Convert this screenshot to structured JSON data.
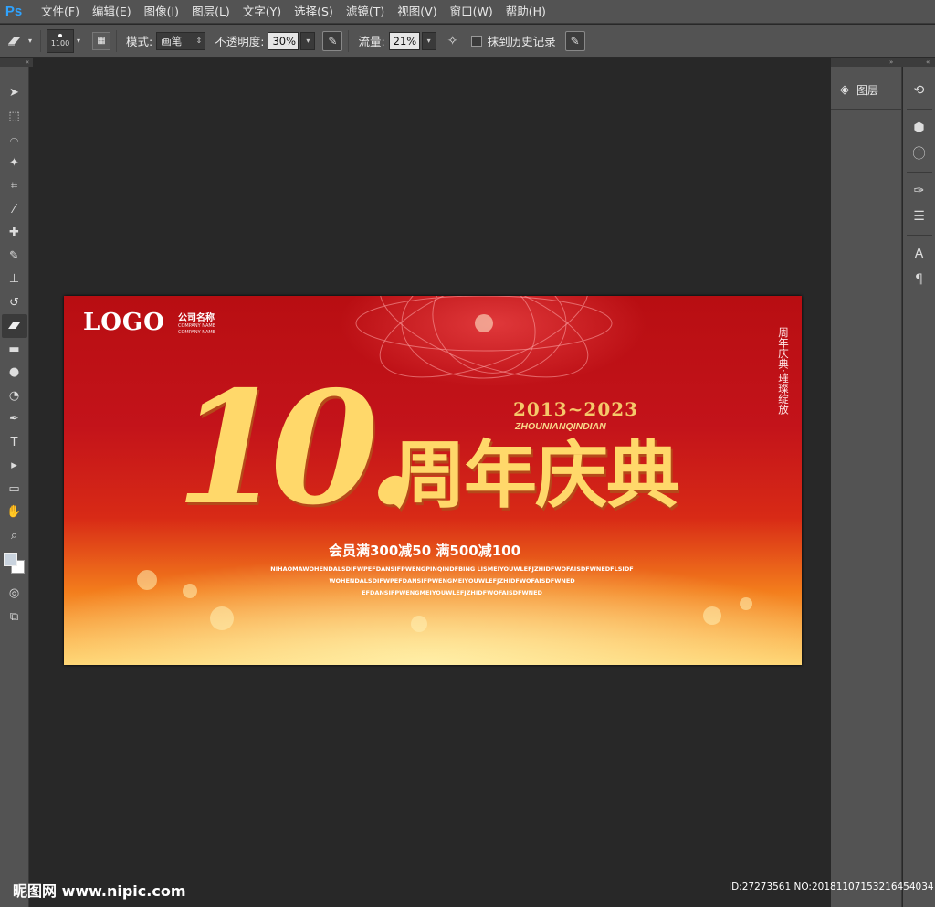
{
  "app": {
    "logo": "Ps"
  },
  "menu": [
    "文件(F)",
    "编辑(E)",
    "图像(I)",
    "图层(L)",
    "文字(Y)",
    "选择(S)",
    "滤镜(T)",
    "视图(V)",
    "窗口(W)",
    "帮助(H)"
  ],
  "options": {
    "brush_size": "1100",
    "mode_label": "模式:",
    "mode_value": "画笔",
    "opacity_label": "不透明度:",
    "opacity_value": "30%",
    "flow_label": "流量:",
    "flow_value": "21%",
    "erase_history_label": "抹到历史记录"
  },
  "panels": {
    "layers_label": "图层"
  },
  "canvas": {
    "logo": "LOGO",
    "company_cn": "公司名称",
    "company_en_1": "COMPANY NAME",
    "company_en_2": "COMPANY NAME",
    "years": "2013~2023",
    "pinyin": "ZHOUNIANQINDIAN",
    "big_number": "10.",
    "title": "周年庆典",
    "promo": "会员满300减50 满500减100",
    "small_lines": [
      "NIHAOMAWOHENDALSDIFWPEFDANSIFPWENGPINQINDFBING LISMEIYOUWLEFJZHIDFWOFAISDFWNEDFLSIDF",
      "WOHENDALSDIFWPEFDANSIFPWENGMEIYOUWLEFJZHIDFWOFAISDFWNED",
      "EFDANSIFPWENGMEIYOUWLEFJZHIDFWOFAISDFWNED"
    ],
    "side_text": "周年庆典·璀璨绽放"
  },
  "watermark": {
    "left": "昵图网 www.nipic.com",
    "right": "ID:27273561 NO:20181107153216454034"
  },
  "colors": {
    "ps_blue": "#2fa3ff",
    "chrome": "#535353",
    "workspace": "#282828",
    "gold": "#ffd86a"
  }
}
